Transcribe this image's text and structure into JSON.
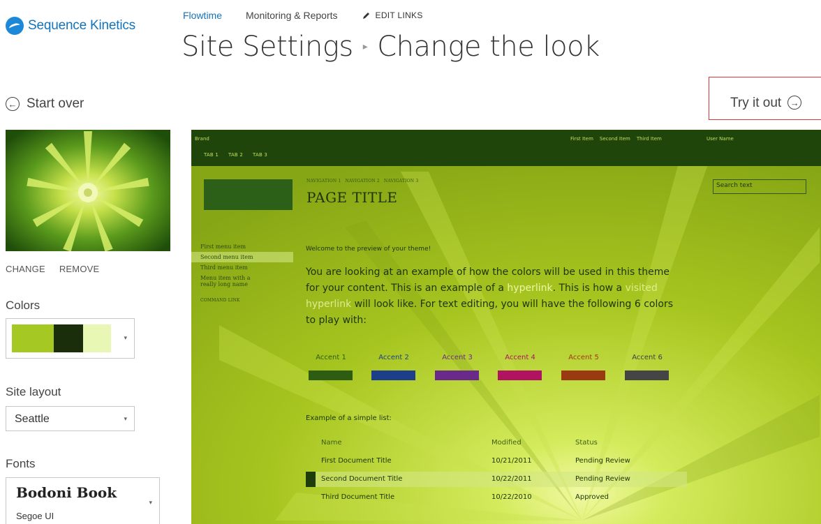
{
  "brand": {
    "name": "Sequence Kinetics"
  },
  "topnav": [
    {
      "label": "Flowtime",
      "active": true
    },
    {
      "label": "Monitoring & Reports",
      "active": false
    }
  ],
  "edit_links": {
    "label": "EDIT LINKS",
    "icon": "pencil-icon"
  },
  "title": {
    "parent": "Site Settings",
    "separator": "▸",
    "current": "Change the look"
  },
  "start_over": {
    "label": "Start over",
    "icon": "circle-left-arrow-icon"
  },
  "try_it_out": {
    "label": "Try it out",
    "icon": "circle-right-arrow-icon"
  },
  "image_panel": {
    "change": "CHANGE",
    "remove": "REMOVE"
  },
  "colors": {
    "label": "Colors",
    "swatches": [
      "#a6c822",
      "#1a2e0b",
      "#e8f7b4"
    ]
  },
  "site_layout": {
    "label": "Site layout",
    "value": "Seattle"
  },
  "fonts": {
    "label": "Fonts",
    "primary": "Bodoni Book",
    "secondary": "Segoe UI"
  },
  "preview": {
    "brand": "Brand",
    "tabs": [
      "TAB 1",
      "TAB 2",
      "TAB 3"
    ],
    "top_links": [
      "First Item",
      "Second Item",
      "Third Item"
    ],
    "user": "User Name",
    "nav": [
      "NAVIGATION 1",
      "NAVIGATION 2",
      "NAVIGATION 3"
    ],
    "page_title": "PAGE TITLE",
    "search": "Search text",
    "menu": {
      "items": [
        "First menu item",
        "Second menu item",
        "Third menu item",
        "Menu item with a really long name"
      ],
      "command": "COMMAND LINK"
    },
    "welcome": "Welcome to the preview of your theme!",
    "body": {
      "p1": "You are looking at an example of how the colors will be used in this theme for your content. This is an example of a ",
      "link": "hyperlink",
      "p2": ". This is how a ",
      "visited": "visited hyperlink",
      "p3": " will look like. For text editing, you will have the following 6 colors to play with:"
    },
    "accents": [
      {
        "label": "Accent 1",
        "color": "#2d5c12",
        "text_color": "#2d5c12"
      },
      {
        "label": "Accent 2",
        "color": "#1d3f8a",
        "text_color": "#1d3f8a"
      },
      {
        "label": "Accent 3",
        "color": "#6a2a8a",
        "text_color": "#6a2a8a"
      },
      {
        "label": "Accent 4",
        "color": "#b0135f",
        "text_color": "#b0135f"
      },
      {
        "label": "Accent 5",
        "color": "#9a3a10",
        "text_color": "#a03a12"
      },
      {
        "label": "Accent 6",
        "color": "#454545",
        "text_color": "#404040"
      }
    ],
    "list": {
      "title": "Example of a simple list:",
      "headers": [
        "Name",
        "Modified",
        "Status"
      ],
      "rows": [
        [
          "First Document Title",
          "10/21/2011",
          "Pending Review"
        ],
        [
          "Second Document Title",
          "10/22/2011",
          "Pending Review"
        ],
        [
          "Third Document Title",
          "10/22/2010",
          "Approved"
        ]
      ]
    }
  }
}
